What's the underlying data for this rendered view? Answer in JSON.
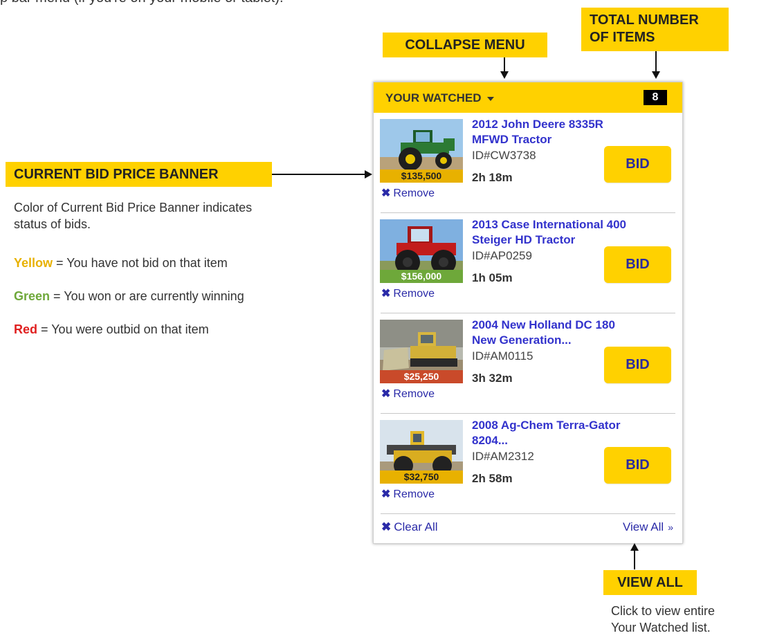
{
  "top_text": "p bar menu (if you're on your mobile or tablet).",
  "callouts": {
    "collapse_menu": "COLLAPSE MENU",
    "total_items": [
      "TOTAL NUMBER",
      "OF ITEMS"
    ],
    "current_bid": "CURRENT BID PRICE BANNER",
    "view_all": "VIEW ALL"
  },
  "bid_banner_desc": [
    "Color of Current Bid Price Banner indicates",
    "status of bids."
  ],
  "legend": [
    {
      "word": "Yellow",
      "color": "#e8b100",
      "text": " = You have not bid on that item"
    },
    {
      "word": "Green",
      "color": "#6ea83a",
      "text": " = You won or are currently winning"
    },
    {
      "word": "Red",
      "color": "#e02020",
      "text": " = You were outbid on that item"
    }
  ],
  "view_all_desc": [
    "Click to view entire",
    "Your Watched list."
  ],
  "widget": {
    "title": "YOUR WATCHED",
    "count": "8",
    "remove_label": "Remove",
    "bid_label": "BID",
    "clear_all_label": "Clear All",
    "view_all_label": "View All",
    "items": [
      {
        "title_lines": [
          "2012 John Deere 8335R",
          "MFWD Tractor"
        ],
        "id": "ID#CW3738",
        "time": "2h 18m",
        "price": "$135,500",
        "status": "yellow",
        "banner_color": "#e8b100",
        "banner_text_color": "#222"
      },
      {
        "title_lines": [
          "2013 Case International 400",
          "Steiger HD Tractor"
        ],
        "id": "ID#AP0259",
        "time": "1h 05m",
        "price": "$156,000",
        "status": "green",
        "banner_color": "#6ea83a",
        "banner_text_color": "#ffffff"
      },
      {
        "title_lines": [
          "2004 New Holland DC 180",
          "New Generation..."
        ],
        "id": "ID#AM0115",
        "time": "3h 32m",
        "price": "$25,250",
        "status": "red",
        "banner_color": "#c94a2a",
        "banner_text_color": "#ffffff"
      },
      {
        "title_lines": [
          "2008 Ag-Chem Terra-Gator",
          "8204..."
        ],
        "id": "ID#AM2312",
        "time": "2h 58m",
        "price": "$32,750",
        "status": "yellow",
        "banner_color": "#e8b100",
        "banner_text_color": "#222"
      }
    ]
  },
  "colors": {
    "accent_yellow": "#ffd100",
    "link_blue": "#2a2aa8"
  }
}
